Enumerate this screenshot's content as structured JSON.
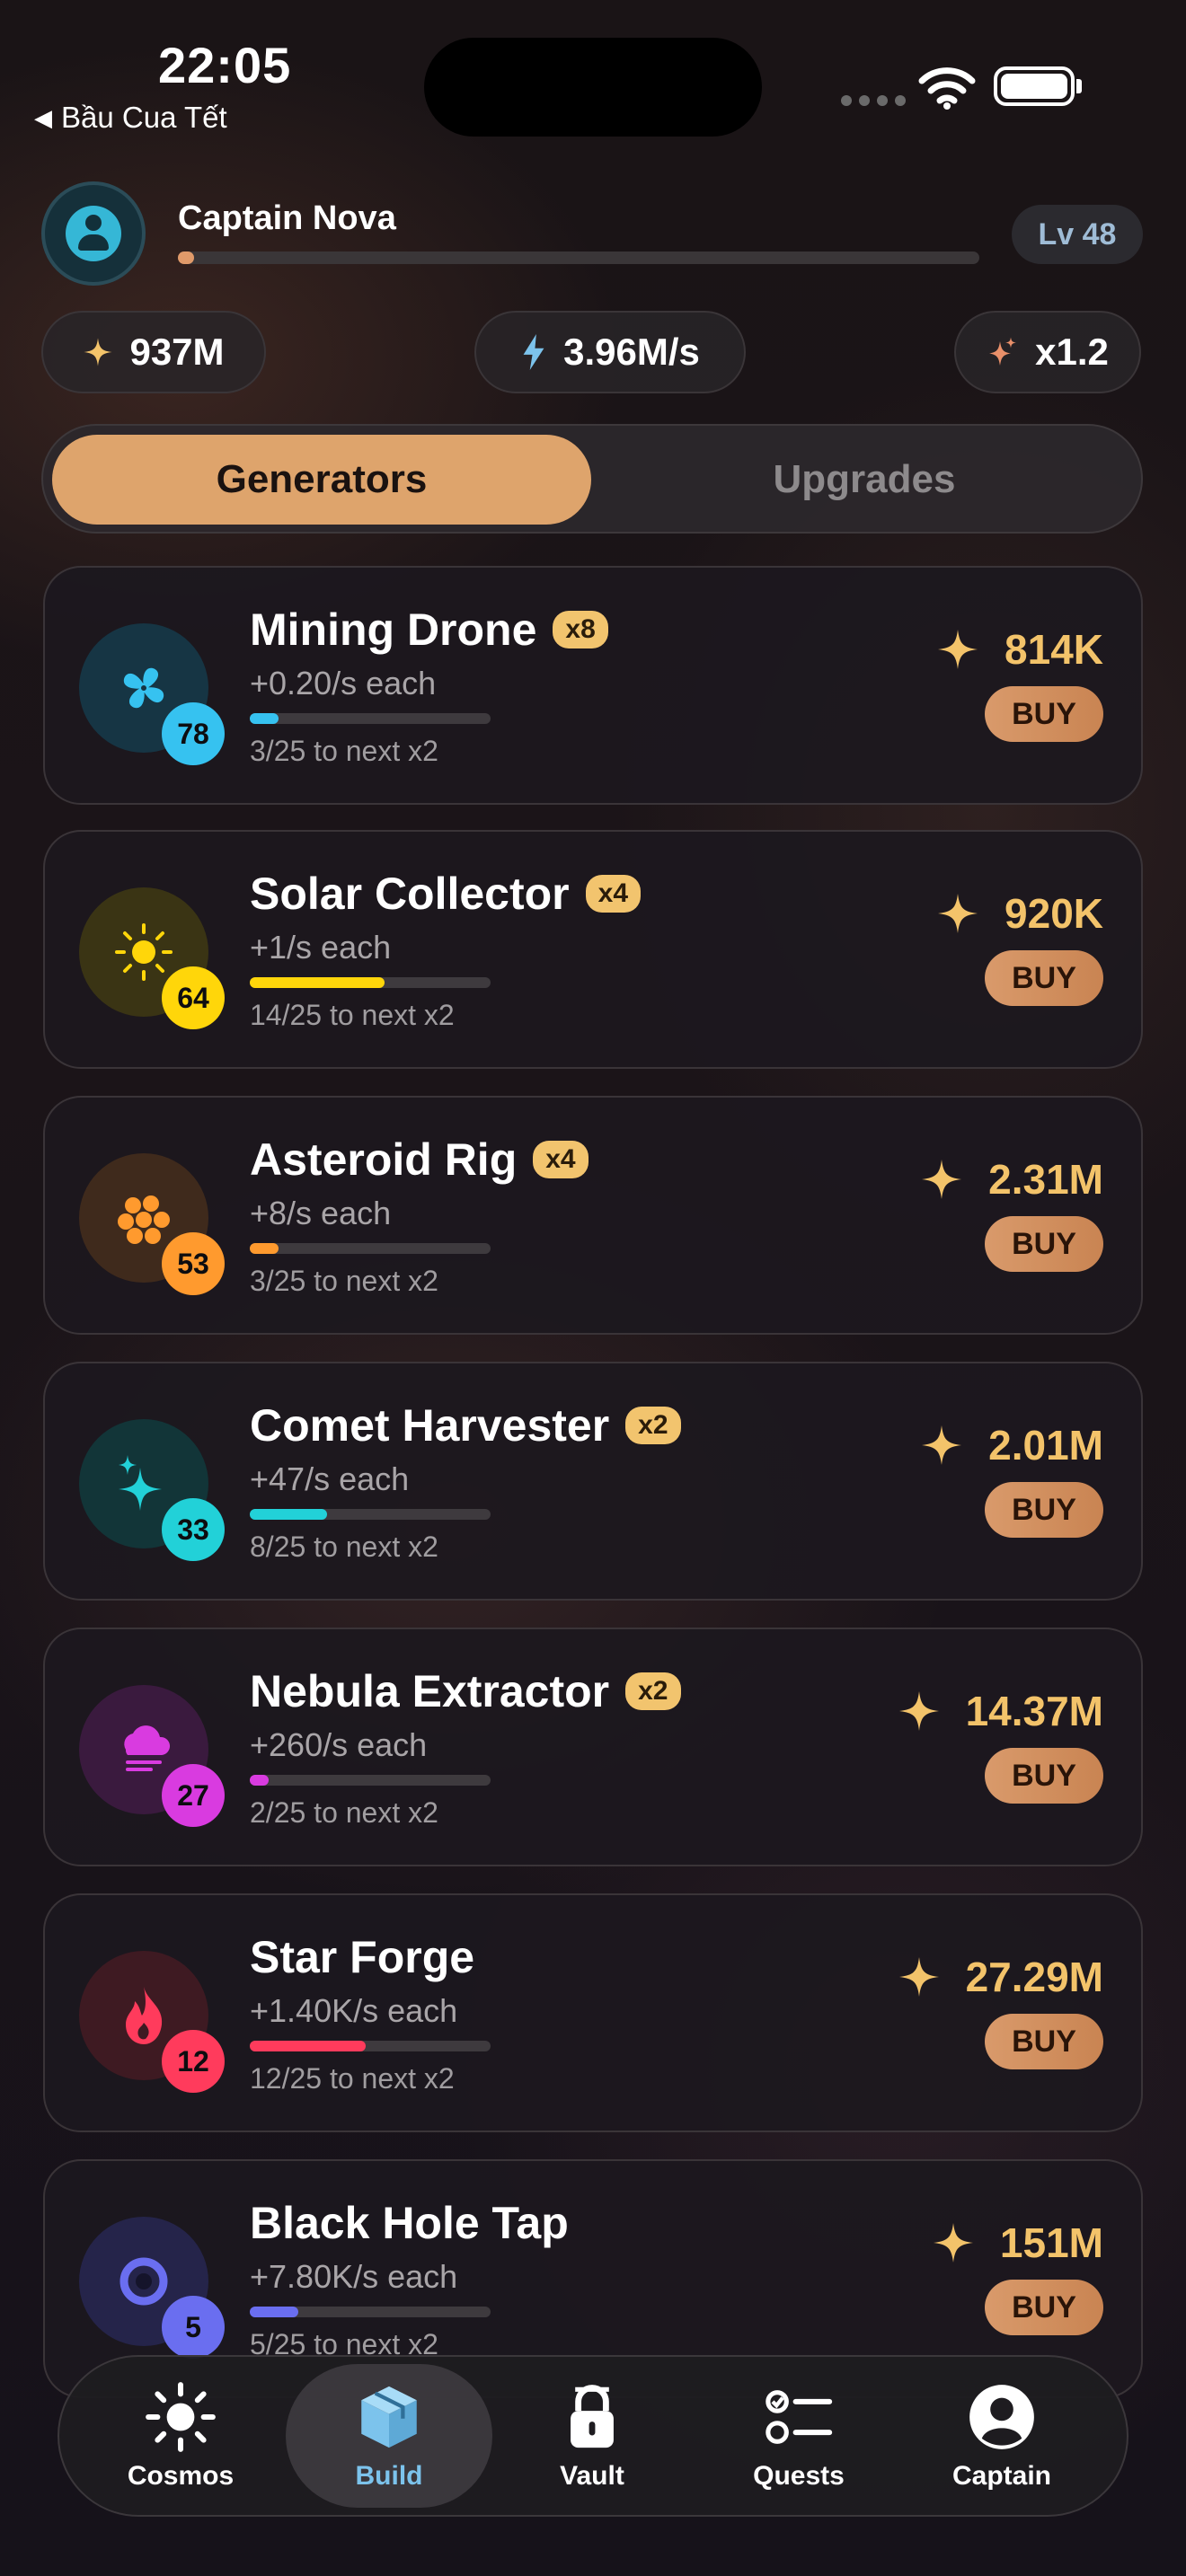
{
  "status_bar": {
    "time": "22:05",
    "back_app": "Bầu Cua Tết"
  },
  "profile": {
    "name": "Captain Nova",
    "level": "Lv 48",
    "xp_progress": 0.02
  },
  "stats": {
    "currency": "937M",
    "rate": "3.96M/s",
    "multiplier": "x1.2"
  },
  "segments": {
    "active": "Generators",
    "other": "Upgrades"
  },
  "generators": [
    {
      "name": "Mining Drone",
      "mult": "x8",
      "rate": "+0.20/s each",
      "progress_text": "3/25 to next x2",
      "progress": 0.12,
      "count": "78",
      "cost": "814K",
      "buy": "BUY",
      "icon": "fan-icon",
      "color": "#36c2f0",
      "bg": "#163544"
    },
    {
      "name": "Solar Collector",
      "mult": "x4",
      "rate": "+1/s each",
      "progress_text": "14/25 to next x2",
      "progress": 0.56,
      "count": "64",
      "cost": "920K",
      "buy": "BUY",
      "icon": "sun-icon",
      "color": "#ffd60a",
      "bg": "#3a3414"
    },
    {
      "name": "Asteroid Rig",
      "mult": "x4",
      "rate": "+8/s each",
      "progress_text": "3/25 to next x2",
      "progress": 0.12,
      "count": "53",
      "cost": "2.31M",
      "buy": "BUY",
      "icon": "asteroid-icon",
      "color": "#ff9a2e",
      "bg": "#3f2a1c"
    },
    {
      "name": "Comet Harvester",
      "mult": "x2",
      "rate": "+47/s each",
      "progress_text": "8/25 to next x2",
      "progress": 0.32,
      "count": "33",
      "cost": "2.01M",
      "buy": "BUY",
      "icon": "sparkles-icon",
      "color": "#22d1d8",
      "bg": "#123538"
    },
    {
      "name": "Nebula Extractor",
      "mult": "x2",
      "rate": "+260/s each",
      "progress_text": "2/25 to next x2",
      "progress": 0.08,
      "count": "27",
      "cost": "14.37M",
      "buy": "BUY",
      "icon": "cloud-icon",
      "color": "#d93be0",
      "bg": "#3a1a3e"
    },
    {
      "name": "Star Forge",
      "mult": "",
      "rate": "+1.40K/s each",
      "progress_text": "12/25 to next x2",
      "progress": 0.48,
      "count": "12",
      "cost": "27.29M",
      "buy": "BUY",
      "icon": "flame-icon",
      "color": "#ff3b5c",
      "bg": "#3e1a22"
    },
    {
      "name": "Black Hole Tap",
      "mult": "",
      "rate": "+7.80K/s each",
      "progress_text": "5/25 to next x2",
      "progress": 0.2,
      "count": "5",
      "cost": "151M",
      "buy": "BUY",
      "icon": "blackhole-icon",
      "color": "#6a6ef0",
      "bg": "#25244a"
    }
  ],
  "tabs": [
    {
      "label": "Cosmos",
      "icon": "sun-icon"
    },
    {
      "label": "Build",
      "icon": "cube-icon"
    },
    {
      "label": "Vault",
      "icon": "lock-icon"
    },
    {
      "label": "Quests",
      "icon": "checklist-icon"
    },
    {
      "label": "Captain",
      "icon": "person-circle-icon"
    }
  ],
  "colors": {
    "accent": "#dea46c",
    "gold": "#f3c36a",
    "active_tab": "#7cc3ec"
  }
}
